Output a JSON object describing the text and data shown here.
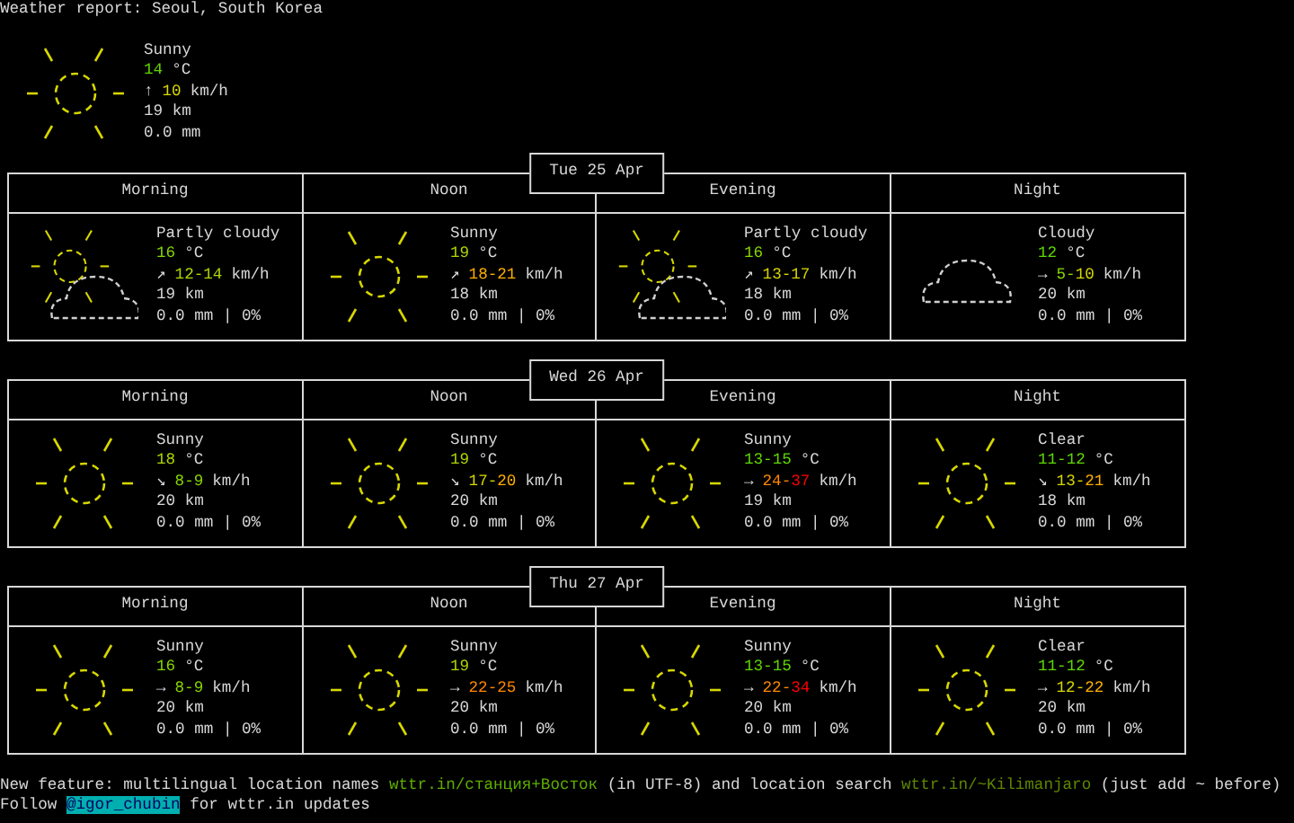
{
  "title": "Weather report: Seoul, South Korea",
  "current": {
    "kind": "sunny",
    "condition": "Sunny",
    "temp": [
      {
        "text": "14",
        "color": "#5fd700"
      }
    ],
    "temp_unit": "°C",
    "wind_dir": "↑",
    "wind": [
      {
        "text": "10",
        "color": "#d7d700"
      }
    ],
    "wind_unit": "km/h",
    "visibility": "19 km",
    "precip": "0.0 mm"
  },
  "days": [
    {
      "date": "Tue 25 Apr",
      "periods": [
        {
          "name": "Morning",
          "kind": "partly_cloudy",
          "condition": "Partly cloudy",
          "temp": [
            {
              "text": "16",
              "color": "#87d700"
            }
          ],
          "temp_unit": "°C",
          "wind_dir": "↗",
          "wind": [
            {
              "text": "12-14",
              "color": "#afd700"
            }
          ],
          "wind_unit": "km/h",
          "visibility": "19 km",
          "precip": "0.0 mm | 0%"
        },
        {
          "name": "Noon",
          "kind": "sunny",
          "condition": "Sunny",
          "temp": [
            {
              "text": "19",
              "color": "#afd700"
            }
          ],
          "temp_unit": "°C",
          "wind_dir": "↗",
          "wind": [
            {
              "text": "18-21",
              "color": "#ffaf00"
            }
          ],
          "wind_unit": "km/h",
          "visibility": "18 km",
          "precip": "0.0 mm | 0%"
        },
        {
          "name": "Evening",
          "kind": "partly_cloudy",
          "condition": "Partly cloudy",
          "temp": [
            {
              "text": "16",
              "color": "#87d700"
            }
          ],
          "temp_unit": "°C",
          "wind_dir": "↗",
          "wind": [
            {
              "text": "13-17",
              "color": "#d7d700"
            }
          ],
          "wind_unit": "km/h",
          "visibility": "18 km",
          "precip": "0.0 mm | 0%"
        },
        {
          "name": "Night",
          "kind": "cloudy",
          "condition": "Cloudy",
          "temp": [
            {
              "text": "12",
              "color": "#5fd700"
            }
          ],
          "temp_unit": "°C",
          "wind_dir": "→",
          "wind": [
            {
              "text": "5-",
              "color": "#87d700"
            },
            {
              "text": "10",
              "color": "#d7d700"
            }
          ],
          "wind_unit": "km/h",
          "visibility": "20 km",
          "precip": "0.0 mm | 0%"
        }
      ]
    },
    {
      "date": "Wed 26 Apr",
      "periods": [
        {
          "name": "Morning",
          "kind": "sunny",
          "condition": "Sunny",
          "temp": [
            {
              "text": "18",
              "color": "#afd700"
            }
          ],
          "temp_unit": "°C",
          "wind_dir": "↘",
          "wind": [
            {
              "text": "8-9",
              "color": "#87d700"
            }
          ],
          "wind_unit": "km/h",
          "visibility": "20 km",
          "precip": "0.0 mm | 0%"
        },
        {
          "name": "Noon",
          "kind": "sunny",
          "condition": "Sunny",
          "temp": [
            {
              "text": "19",
              "color": "#afd700"
            }
          ],
          "temp_unit": "°C",
          "wind_dir": "↘",
          "wind": [
            {
              "text": "17-",
              "color": "#d7d700"
            },
            {
              "text": "20",
              "color": "#ffaf00"
            }
          ],
          "wind_unit": "km/h",
          "visibility": "20 km",
          "precip": "0.0 mm | 0%"
        },
        {
          "name": "Evening",
          "kind": "sunny",
          "condition": "Sunny",
          "temp": [
            {
              "text": "13-15",
              "color": "#5fd700"
            }
          ],
          "temp_unit": "°C",
          "wind_dir": "→",
          "wind": [
            {
              "text": "24-",
              "color": "#ff8700"
            },
            {
              "text": "37",
              "color": "#ff0000"
            }
          ],
          "wind_unit": "km/h",
          "visibility": "19 km",
          "precip": "0.0 mm | 0%"
        },
        {
          "name": "Night",
          "kind": "sunny",
          "condition": "Clear",
          "temp": [
            {
              "text": "11-12",
              "color": "#5fd700"
            }
          ],
          "temp_unit": "°C",
          "wind_dir": "↘",
          "wind": [
            {
              "text": "13-",
              "color": "#d7d700"
            },
            {
              "text": "21",
              "color": "#ffaf00"
            }
          ],
          "wind_unit": "km/h",
          "visibility": "18 km",
          "precip": "0.0 mm | 0%"
        }
      ]
    },
    {
      "date": "Thu 27 Apr",
      "periods": [
        {
          "name": "Morning",
          "kind": "sunny",
          "condition": "Sunny",
          "temp": [
            {
              "text": "16",
              "color": "#87d700"
            }
          ],
          "temp_unit": "°C",
          "wind_dir": "→",
          "wind": [
            {
              "text": "8-9",
              "color": "#87d700"
            }
          ],
          "wind_unit": "km/h",
          "visibility": "20 km",
          "precip": "0.0 mm | 0%"
        },
        {
          "name": "Noon",
          "kind": "sunny",
          "condition": "Sunny",
          "temp": [
            {
              "text": "19",
              "color": "#afd700"
            }
          ],
          "temp_unit": "°C",
          "wind_dir": "→",
          "wind": [
            {
              "text": "22-25",
              "color": "#ff8700"
            }
          ],
          "wind_unit": "km/h",
          "visibility": "20 km",
          "precip": "0.0 mm | 0%"
        },
        {
          "name": "Evening",
          "kind": "sunny",
          "condition": "Sunny",
          "temp": [
            {
              "text": "13-15",
              "color": "#5fd700"
            }
          ],
          "temp_unit": "°C",
          "wind_dir": "→",
          "wind": [
            {
              "text": "22-",
              "color": "#ff8700"
            },
            {
              "text": "34",
              "color": "#ff0000"
            }
          ],
          "wind_unit": "km/h",
          "visibility": "20 km",
          "precip": "0.0 mm | 0%"
        },
        {
          "name": "Night",
          "kind": "sunny",
          "condition": "Clear",
          "temp": [
            {
              "text": "11-12",
              "color": "#5fd700"
            }
          ],
          "temp_unit": "°C",
          "wind_dir": "→",
          "wind": [
            {
              "text": "12-",
              "color": "#d7d700"
            },
            {
              "text": "22",
              "color": "#ffaf00"
            }
          ],
          "wind_unit": "km/h",
          "visibility": "20 km",
          "precip": "0.0 mm | 0%"
        }
      ]
    }
  ],
  "footer": [
    [
      {
        "kind": "plain",
        "text": "New feature: multilingual location names "
      },
      {
        "kind": "link",
        "text": "wttr.in/станция+Восток"
      },
      {
        "kind": "plain",
        "text": " (in UTF-8) and location search "
      },
      {
        "kind": "link_dim",
        "text": "wttr.in/~Kilimanjaro"
      },
      {
        "kind": "plain",
        "text": " (just add ~ before)"
      }
    ],
    [
      {
        "kind": "plain",
        "text": "Follow "
      },
      {
        "kind": "handle",
        "text": "@igor_chubin"
      },
      {
        "kind": "plain",
        "text": " for wttr.in updates"
      }
    ]
  ]
}
